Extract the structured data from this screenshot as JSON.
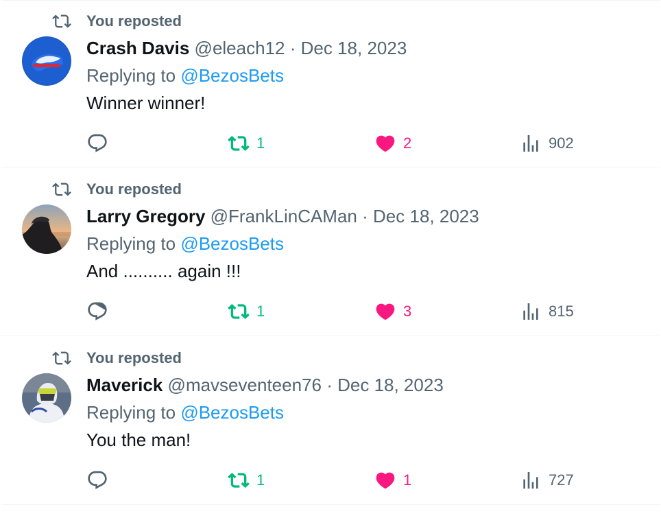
{
  "colors": {
    "muted": "#536471",
    "link": "#1d9bf0",
    "repost_active": "#00ba7c",
    "like_active": "#f91880"
  },
  "icons": {
    "repost_banner": "repost-icon",
    "reply": "reply-icon",
    "repost": "repost-icon",
    "like": "heart-icon",
    "views": "views-icon"
  },
  "tweets": [
    {
      "repost_label": "You reposted",
      "name": "Crash Davis",
      "handle": "@eleach12",
      "dot": "·",
      "date": "Dec 18, 2023",
      "replying_prefix": "Replying to ",
      "replying_to": "@BezosBets",
      "text": "Winner winner!",
      "reposts": "1",
      "likes": "2",
      "views": "902"
    },
    {
      "repost_label": "You reposted",
      "name": "Larry Gregory",
      "handle": "@FrankLinCAMan",
      "dot": "·",
      "date": "Dec 18, 2023",
      "replying_prefix": "Replying to ",
      "replying_to": "@BezosBets",
      "text": "And .......... again !!!",
      "reposts": "1",
      "likes": "3",
      "views": "815"
    },
    {
      "repost_label": "You reposted",
      "name": "Maverick",
      "handle": "@mavseventeen76",
      "dot": "·",
      "date": "Dec 18, 2023",
      "replying_prefix": "Replying to ",
      "replying_to": "@BezosBets",
      "text": "You the man!",
      "reposts": "1",
      "likes": "1",
      "views": "727"
    }
  ]
}
